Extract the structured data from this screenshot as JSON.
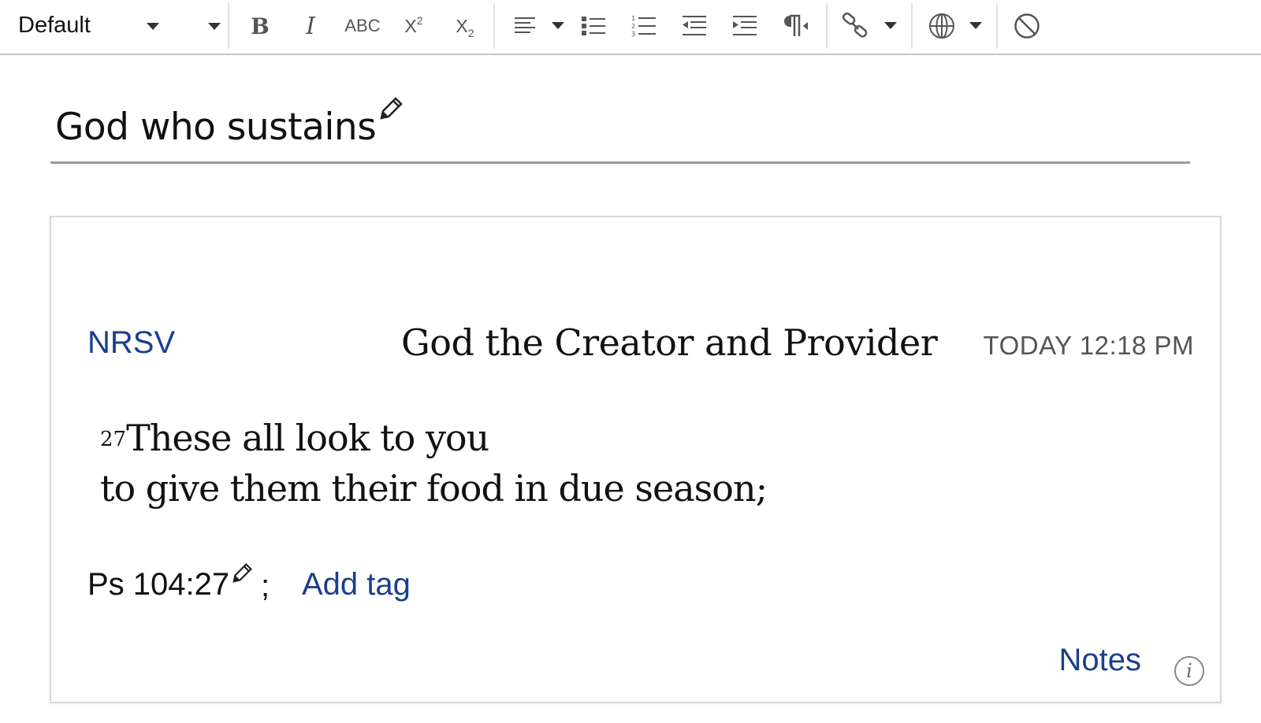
{
  "toolbar": {
    "paragraph_style": "Default",
    "strikethrough_label": "ABC",
    "icons": [
      "chevron-down-icon",
      "font-size-chevron-icon",
      "bold-icon",
      "italic-icon",
      "strikethrough-icon",
      "superscript-icon",
      "subscript-icon",
      "align-left-icon",
      "align-chevron-icon",
      "bulleted-list-icon",
      "numbered-list-icon",
      "outdent-icon",
      "indent-icon",
      "paragraph-direction-icon",
      "link-icon",
      "link-chevron-icon",
      "globe-icon",
      "language-chevron-icon",
      "clear-formatting-icon"
    ]
  },
  "note": {
    "title": "God who sustains"
  },
  "card": {
    "version": "NRSV",
    "heading": "God the Creator and Provider",
    "timestamp": "TODAY 12:18 PM",
    "verse_number": "27",
    "verse_line1": "These all look to you",
    "verse_line2": "to give them their food in due season;",
    "reference": "Ps 104:27",
    "separator": ";",
    "add_tag_label": "Add tag",
    "notes_label": "Notes",
    "info_symbol": "i"
  },
  "colors": {
    "link_blue": "#1a3f8c",
    "text": "#111111",
    "muted": "#555555"
  }
}
